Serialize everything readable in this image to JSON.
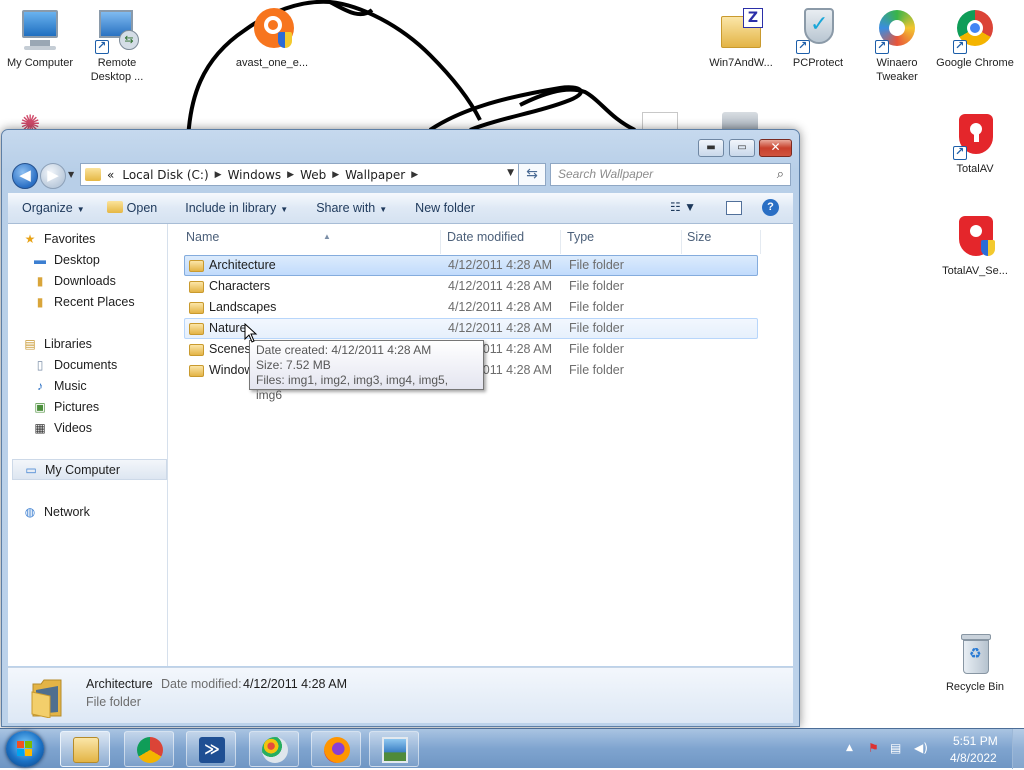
{
  "desktop": {
    "icons": [
      {
        "label": "My Computer"
      },
      {
        "label": "Remote Desktop ..."
      },
      {
        "label": "avast_one_e..."
      },
      {
        "label": "Win7AndW..."
      },
      {
        "label": "PCProtect"
      },
      {
        "label": "Winaero Tweaker"
      },
      {
        "label": "Google Chrome"
      },
      {
        "label": "TotalAV"
      },
      {
        "label": "TotalAV_Se..."
      },
      {
        "label": "Recycle Bin"
      }
    ]
  },
  "window": {
    "caption_buttons": {
      "minimize": "▬",
      "maximize": "▭",
      "close": "✕"
    },
    "back": "◀",
    "forward": "▶",
    "address": {
      "overflow": "«",
      "crumbs": [
        "Local Disk (C:)",
        "Windows",
        "Web",
        "Wallpaper"
      ]
    },
    "search_placeholder": "Search Wallpaper",
    "toolbar": {
      "organize": "Organize",
      "open": "Open",
      "include_in_library": "Include in library",
      "share_with": "Share with",
      "new_folder": "New folder"
    },
    "nav": {
      "favorites": "Favorites",
      "desktop": "Desktop",
      "downloads": "Downloads",
      "recent_places": "Recent Places",
      "libraries": "Libraries",
      "documents": "Documents",
      "music": "Music",
      "pictures": "Pictures",
      "videos": "Videos",
      "my_computer": "My Computer",
      "network": "Network"
    },
    "columns": {
      "name": "Name",
      "date_modified": "Date modified",
      "type": "Type",
      "size": "Size"
    },
    "files": [
      {
        "name": "Architecture",
        "date": "4/12/2011 4:28 AM",
        "type": "File folder"
      },
      {
        "name": "Characters",
        "date": "4/12/2011 4:28 AM",
        "type": "File folder"
      },
      {
        "name": "Landscapes",
        "date": "4/12/2011 4:28 AM",
        "type": "File folder"
      },
      {
        "name": "Nature",
        "date": "4/12/2011 4:28 AM",
        "type": "File folder"
      },
      {
        "name": "Scenes",
        "date": "4/12/2011 4:28 AM",
        "type": "File folder"
      },
      {
        "name": "Windows",
        "date": "4/12/2011 4:28 AM",
        "type": "File folder"
      }
    ],
    "tooltip": {
      "created": "Date created: 4/12/2011 4:28 AM",
      "size": "Size: 7.52 MB",
      "files": "Files: img1, img2, img3, img4, img5, img6"
    },
    "details": {
      "name": "Architecture",
      "modified_label": "Date modified:",
      "modified_value": "4/12/2011 4:28 AM",
      "type": "File folder"
    }
  },
  "taskbar": {
    "clock_time": "5:51 PM",
    "clock_date": "4/8/2022"
  },
  "colors": {
    "selection": "#c1dbfc",
    "window_frame": "#b8cfe8",
    "taskbar": "#7fa4cf"
  }
}
